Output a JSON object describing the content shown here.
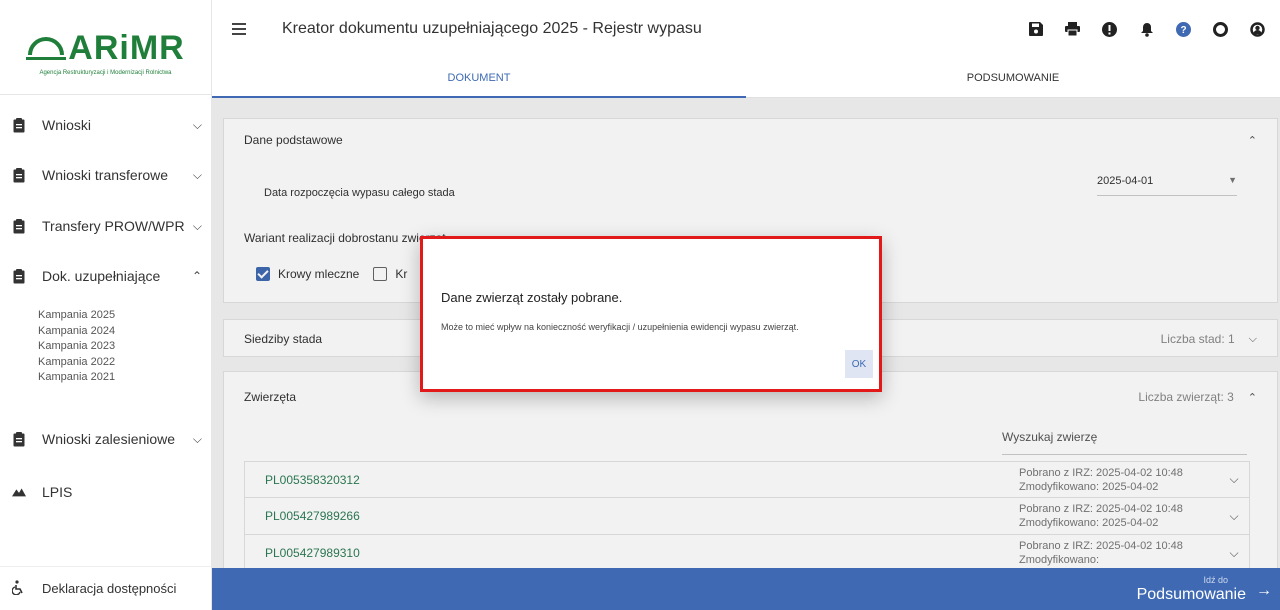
{
  "brand": {
    "name": "ARiMR",
    "subtitle": "Agencja Restrukturyzacji i Modernizacji Rolnictwa",
    "color": "#1f7f3a"
  },
  "header": {
    "title": "Kreator dokumentu uzupełniającego 2025 - Rejestr wypasu"
  },
  "toolbar_icons": [
    "save-icon",
    "print-icon",
    "alert-icon",
    "bell-icon",
    "help-icon",
    "circle-icon",
    "user-icon"
  ],
  "tabs": [
    {
      "label": "DOKUMENT",
      "active": true
    },
    {
      "label": "PODSUMOWANIE",
      "active": false
    }
  ],
  "sidebar": {
    "items": [
      {
        "label": "Wnioski",
        "icon": "clipboard-icon",
        "expanded": false
      },
      {
        "label": "Wnioski transferowe",
        "icon": "clipboard-icon",
        "expanded": false
      },
      {
        "label": "Transfery PROW/WPR",
        "icon": "clipboard-icon",
        "expanded": false
      },
      {
        "label": "Dok. uzupełniające",
        "icon": "clipboard-icon",
        "expanded": true
      },
      {
        "label": "Wnioski zalesieniowe",
        "icon": "clipboard-icon",
        "expanded": false
      },
      {
        "label": "LPIS",
        "icon": "mountain-icon"
      }
    ],
    "subitems": [
      "Kampania 2025",
      "Kampania 2024",
      "Kampania 2023",
      "Kampania 2022",
      "Kampania 2021"
    ],
    "footer": {
      "label": "Deklaracja dostępności",
      "icon": "accessibility-icon"
    }
  },
  "sections": {
    "basic": {
      "title": "Dane podstawowe",
      "start_date_label": "Data rozpoczęcia wypasu całego stada",
      "start_date_value": "2025-04-01",
      "variant_label": "Wariant realizacji dobrostanu zwierząt",
      "options": [
        {
          "label": "Krowy mleczne",
          "checked": true
        },
        {
          "label": "Kr",
          "checked": false
        }
      ]
    },
    "herds": {
      "title": "Siedziby stada",
      "count_text": "Liczba stad: 1"
    },
    "animals": {
      "title": "Zwierzęta",
      "count_text": "Liczba zwierząt: 3",
      "search_placeholder": "Wyszukaj zwierzę",
      "rows": [
        {
          "id": "PL005358320312",
          "line1": "Pobrano z IRZ: 2025-04-02 10:48",
          "line2": "Zmodyfikowano: 2025-04-02"
        },
        {
          "id": "PL005427989266",
          "line1": "Pobrano z IRZ: 2025-04-02 10:48",
          "line2": "Zmodyfikowano: 2025-04-02"
        },
        {
          "id": "PL005427989310",
          "line1": "Pobrano z IRZ: 2025-04-02 10:48",
          "line2": "Zmodyfikowano:"
        }
      ]
    }
  },
  "bottom_bar": {
    "pre_label": "Idź do",
    "label": "Podsumowanie",
    "color": "#3f6ab3"
  },
  "dialog": {
    "title": "Dane zwierząt zostały pobrane.",
    "body": "Może to mieć wpływ na konieczność weryfikacji / uzupełnienia ewidencji wypasu zwierząt.",
    "ok_label": "OK",
    "highlight_color": "#e11919"
  }
}
